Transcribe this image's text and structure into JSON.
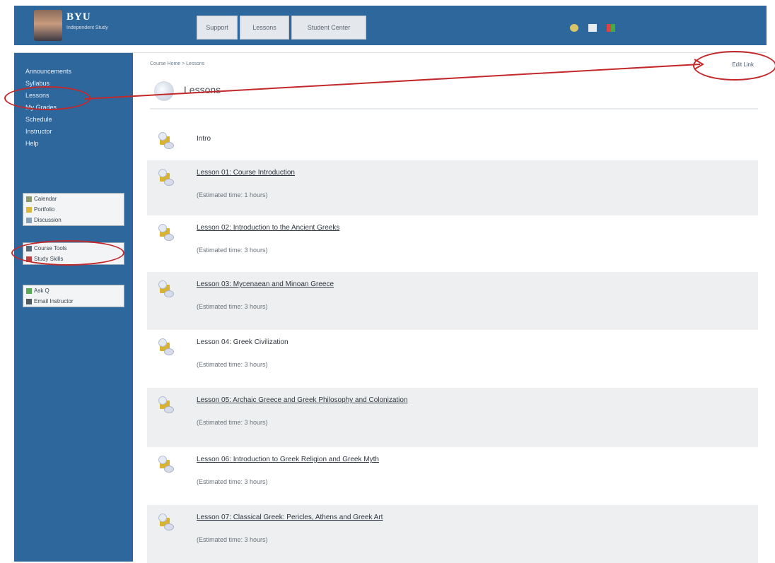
{
  "header": {
    "logo": "BYU",
    "logo_sub": "Independent Study",
    "tabs": [
      "Support",
      "Lessons",
      "Student Center"
    ],
    "icons": [
      "help-icon",
      "mail-icon",
      "settings-icon"
    ]
  },
  "sidebar": {
    "nav": [
      "Announcements",
      "Syllabus",
      "Lessons",
      "My Grades",
      "Schedule",
      "Instructor",
      "Help"
    ],
    "panel1": [
      "Calendar",
      "Portfolio",
      "Discussion"
    ],
    "panel2": [
      "Course Tools",
      "Study Skills"
    ],
    "panel3": [
      "Ask Q",
      "Email Instructor"
    ]
  },
  "main": {
    "breadcrumb": "Course Home > Lessons",
    "edit_link": "Edit Link",
    "page_title": "Lessons",
    "rows": [
      {
        "title": "Intro",
        "sub": "",
        "underline": false,
        "shaded": false
      },
      {
        "title": "Lesson 01: Course Introduction",
        "sub": "(Estimated time: 1 hours)",
        "underline": true,
        "shaded": true
      },
      {
        "title": "Lesson 02: Introduction to the Ancient Greeks",
        "sub": "(Estimated time: 3 hours)",
        "underline": true,
        "shaded": false
      },
      {
        "title": "Lesson 03: Mycenaean and Minoan Greece",
        "sub": "(Estimated time: 3 hours)",
        "underline": true,
        "shaded": true
      },
      {
        "title": "Lesson 04: Greek Civilization",
        "sub": "(Estimated time: 3 hours)",
        "underline": false,
        "shaded": false
      },
      {
        "title": "Lesson 05: Archaic Greece and Greek Philosophy and Colonization",
        "sub": "(Estimated time: 3 hours)",
        "underline": true,
        "shaded": true
      },
      {
        "title": "Lesson 06: Introduction to Greek Religion and Greek Myth",
        "sub": "(Estimated time: 3 hours)",
        "underline": true,
        "shaded": false
      },
      {
        "title": "Lesson 07: Classical Greek: Pericles, Athens and Greek Art",
        "sub": "(Estimated time: 3 hours)",
        "underline": true,
        "shaded": true
      }
    ]
  }
}
